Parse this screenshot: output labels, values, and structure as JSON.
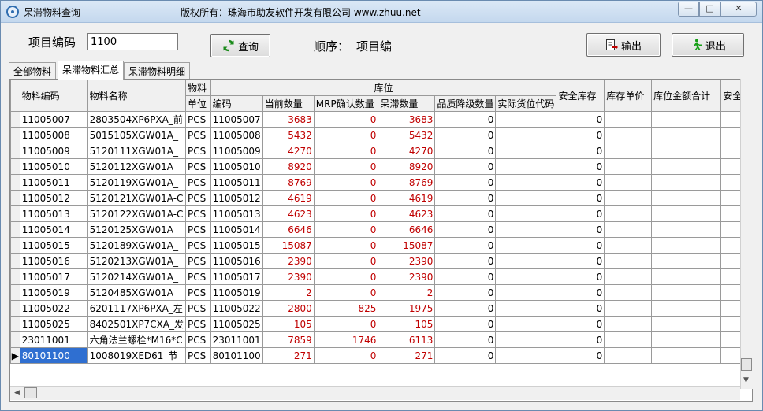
{
  "window": {
    "title": "呆滞物料查询",
    "copyright": "版权所有：珠海市助友软件开发有限公司 www.zhuu.net",
    "minimize_glyph": "—",
    "maximize_glyph": "□",
    "close_glyph": "✕"
  },
  "toolbar": {
    "code_label": "项目编码",
    "code_value": "1100",
    "query_label": "查询",
    "order_label": "顺序：",
    "order_value": "项目编",
    "export_label": "输出",
    "exit_label": "退出"
  },
  "tabs": [
    {
      "label": "全部物料",
      "active": false
    },
    {
      "label": "呆滞物料汇总",
      "active": true
    },
    {
      "label": "呆滞物料明细",
      "active": false
    }
  ],
  "grid": {
    "header_top": {
      "item_code": "物料编码",
      "item_name": "物料名称",
      "material_unit_top": "物料",
      "warehouse_group": "库位",
      "safety_stock": "安全库存",
      "stock_unit_price": "库存单价",
      "location_amount_total": "库位金额合计",
      "truncated": "安全"
    },
    "header_sub": {
      "unit": "单位",
      "code": "编码",
      "current_qty": "当前数量",
      "mrp_qty": "MRP确认数量",
      "slow_qty": "呆滞数量",
      "downgrade_qty": "品质降级数量",
      "actual_location": "实际货位代码"
    },
    "rows": [
      {
        "code": "11005007",
        "name": "2803504XP6PXA_前",
        "unit": "PCS",
        "wh": "11005007",
        "cur": "3683",
        "mrp": "0",
        "slow": "3683",
        "down": "0",
        "safety": "0"
      },
      {
        "code": "11005008",
        "name": "5015105XGW01A_",
        "unit": "PCS",
        "wh": "11005008",
        "cur": "5432",
        "mrp": "0",
        "slow": "5432",
        "down": "0",
        "safety": "0"
      },
      {
        "code": "11005009",
        "name": "5120111XGW01A_",
        "unit": "PCS",
        "wh": "11005009",
        "cur": "4270",
        "mrp": "0",
        "slow": "4270",
        "down": "0",
        "safety": "0"
      },
      {
        "code": "11005010",
        "name": "5120112XGW01A_",
        "unit": "PCS",
        "wh": "11005010",
        "cur": "8920",
        "mrp": "0",
        "slow": "8920",
        "down": "0",
        "safety": "0"
      },
      {
        "code": "11005011",
        "name": "5120119XGW01A_",
        "unit": "PCS",
        "wh": "11005011",
        "cur": "8769",
        "mrp": "0",
        "slow": "8769",
        "down": "0",
        "safety": "0"
      },
      {
        "code": "11005012",
        "name": "5120121XGW01A-C",
        "unit": "PCS",
        "wh": "11005012",
        "cur": "4619",
        "mrp": "0",
        "slow": "4619",
        "down": "0",
        "safety": "0"
      },
      {
        "code": "11005013",
        "name": "5120122XGW01A-C",
        "unit": "PCS",
        "wh": "11005013",
        "cur": "4623",
        "mrp": "0",
        "slow": "4623",
        "down": "0",
        "safety": "0"
      },
      {
        "code": "11005014",
        "name": "5120125XGW01A_",
        "unit": "PCS",
        "wh": "11005014",
        "cur": "6646",
        "mrp": "0",
        "slow": "6646",
        "down": "0",
        "safety": "0"
      },
      {
        "code": "11005015",
        "name": "5120189XGW01A_",
        "unit": "PCS",
        "wh": "11005015",
        "cur": "15087",
        "mrp": "0",
        "slow": "15087",
        "down": "0",
        "safety": "0"
      },
      {
        "code": "11005016",
        "name": "5120213XGW01A_",
        "unit": "PCS",
        "wh": "11005016",
        "cur": "2390",
        "mrp": "0",
        "slow": "2390",
        "down": "0",
        "safety": "0"
      },
      {
        "code": "11005017",
        "name": "5120214XGW01A_",
        "unit": "PCS",
        "wh": "11005017",
        "cur": "2390",
        "mrp": "0",
        "slow": "2390",
        "down": "0",
        "safety": "0"
      },
      {
        "code": "11005019",
        "name": "5120485XGW01A_",
        "unit": "PCS",
        "wh": "11005019",
        "cur": "2",
        "mrp": "0",
        "slow": "2",
        "down": "0",
        "safety": "0"
      },
      {
        "code": "11005022",
        "name": "6201117XP6PXA_左",
        "unit": "PCS",
        "wh": "11005022",
        "cur": "2800",
        "mrp": "825",
        "slow": "1975",
        "down": "0",
        "safety": "0"
      },
      {
        "code": "11005025",
        "name": "8402501XP7CXA_发",
        "unit": "PCS",
        "wh": "11005025",
        "cur": "105",
        "mrp": "0",
        "slow": "105",
        "down": "0",
        "safety": "0"
      },
      {
        "code": "23011001",
        "name": "六角法兰螺栓*M16*C",
        "unit": "PCS",
        "wh": "23011001",
        "cur": "7859",
        "mrp": "1746",
        "slow": "6113",
        "down": "0",
        "safety": "0"
      },
      {
        "code": "80101100",
        "name": "1008019XED61_节",
        "unit": "PCS",
        "wh": "80101100",
        "cur": "271",
        "mrp": "0",
        "slow": "271",
        "down": "0",
        "safety": "0"
      }
    ],
    "selected_row_marker": "▶"
  },
  "colors": {
    "red_values": "#c00000",
    "selection": "#2f6fd1"
  }
}
